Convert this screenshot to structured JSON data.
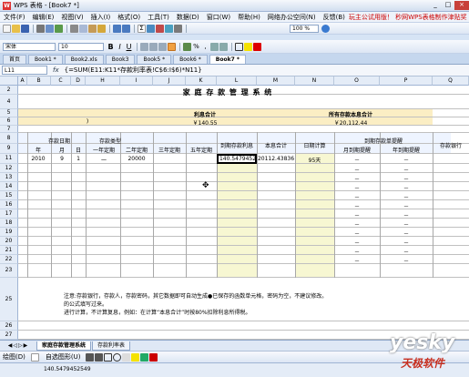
{
  "window": {
    "title": "WPS 表格 - [Book7 *]"
  },
  "menu": {
    "items": [
      "文件(F)",
      "编辑(E)",
      "视图(V)",
      "插入(I)",
      "格式(O)",
      "工具(T)",
      "数据(D)",
      "窗口(W)",
      "帮助(H)",
      "网络办公空间(N)",
      "反馈(B)"
    ],
    "promo": "玩主公试用版！ 秒网WPS表格制作津贴奖"
  },
  "toolbar": {
    "zoom": "100 %",
    "font_name": "宋体",
    "font_size": "10"
  },
  "doc_tabs": [
    "首页",
    "Book1 *",
    "Book2.xls",
    "Book3",
    "Book5 *",
    "Book6 *",
    "Book7 *"
  ],
  "formula": {
    "cell_ref": "L11",
    "fx": "fx",
    "content": "{=SUM(E11:K11*存款利率表!C$6:I$6)*N11}"
  },
  "columns": [
    "A",
    "B",
    "C",
    "D",
    "H",
    "I",
    "J",
    "K",
    "L",
    "M",
    "N",
    "O",
    "P",
    "Q"
  ],
  "sheet": {
    "title": "家 庭 存 款 管 理 系 统",
    "interest_total_label": "利息合计",
    "principal_total_label": "所有存款本息合计",
    "interest_total": "￥140.55",
    "principal_total": "￥20,112.44",
    "col_fragment": ")",
    "deposit_date": "存款日期",
    "deposit_type": "存款类型",
    "year": "年",
    "month": "月",
    "day": "日",
    "t1": "一年定期",
    "t2": "二年定期",
    "t3": "三年定期",
    "t5": "五年定期",
    "due_interest": "到期存款利息",
    "sum_total": "本息合计",
    "days": "日期计算",
    "reminder": "到期存款单提醒",
    "m_rem": "月到期提醒",
    "y_rem": "年到期提醒",
    "bank": "存款银行",
    "row11": {
      "year": "2010",
      "month": "9",
      "day": "1",
      "t1": "一",
      "t3": "20000",
      "interest": "140.5479452",
      "total": "20112.43836",
      "days": "95天",
      "m": "－",
      "y": "－"
    },
    "dash": "－",
    "notes": [
      "注意:存款银行，存款人，存款密码，其它数据即可自动生成●已保存的函数单元格，密码为空，不建议修改。",
      "的公式填写过来。",
      "进行计算，不计算复息，例如：在计算“本息合计”时按80%扣除利息所得税。"
    ]
  },
  "sheet_tabs": [
    "家庭存款管理系统",
    "存款利率表"
  ],
  "drawbar": {
    "draw": "绘图(D)",
    "autoshape": "自选图形(U)"
  },
  "status": {
    "text": "140.5479452549"
  },
  "watermark": {
    "main": "yesky",
    "sub": "天极软件"
  }
}
